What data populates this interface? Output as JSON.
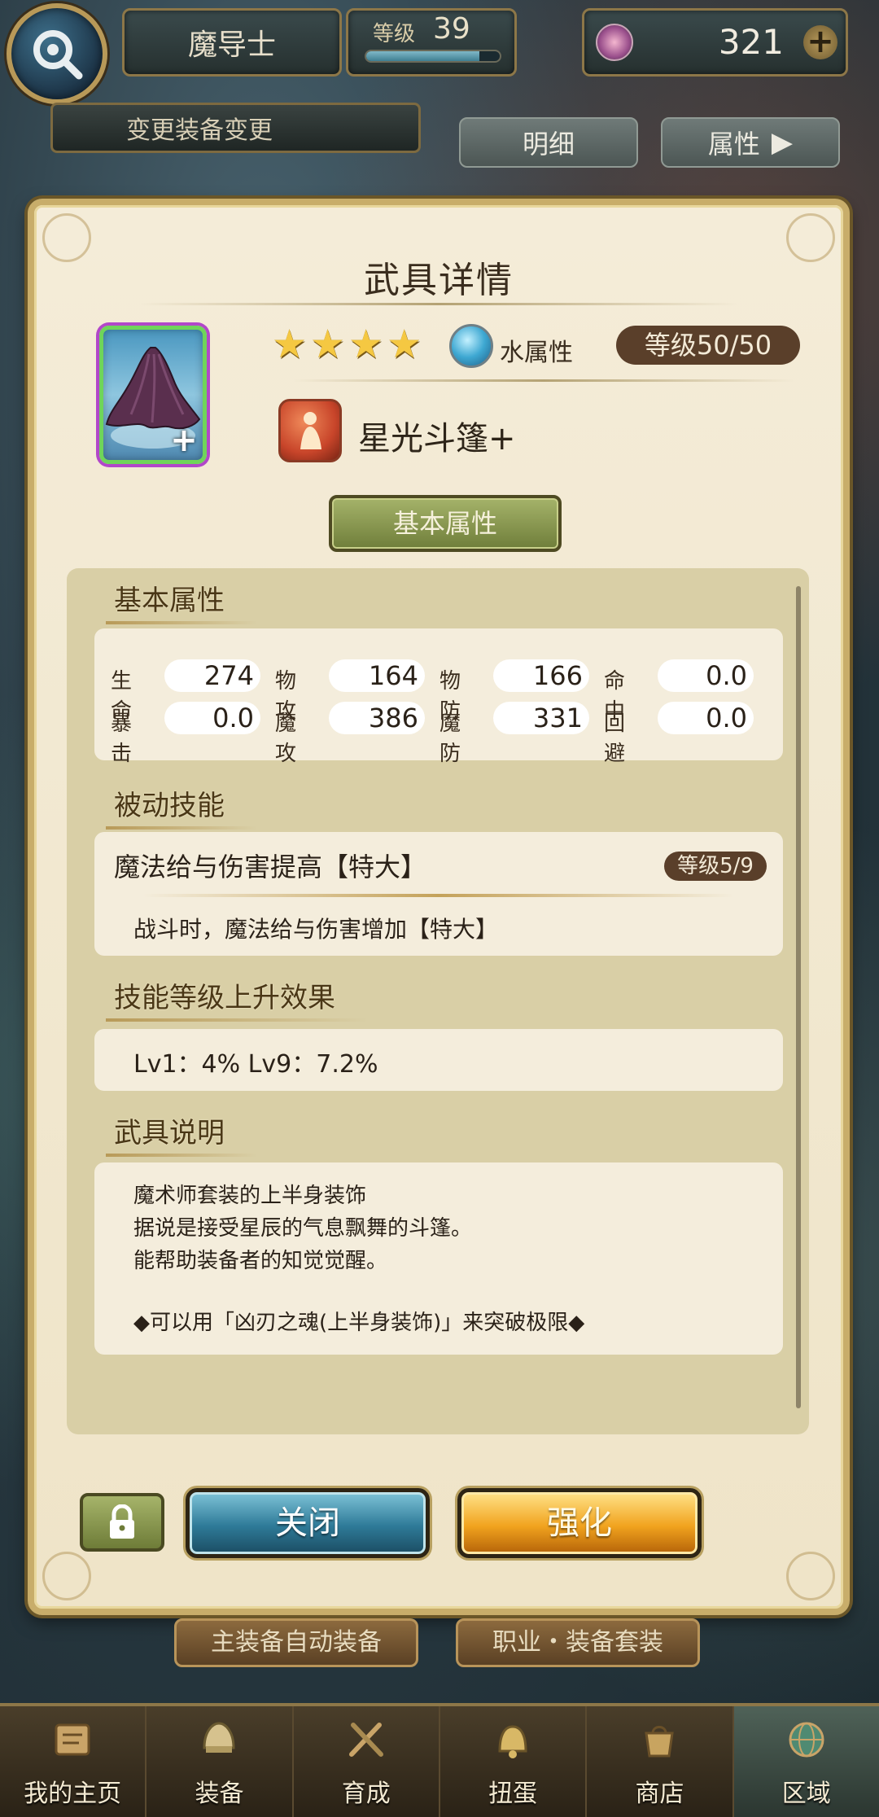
{
  "header": {
    "job": "魔导士",
    "level_label": "等级",
    "level_value": "39",
    "level_progress": 0.85,
    "gems": "321"
  },
  "top_actions": {
    "change_equip": "变更装备变更",
    "detail": "明细",
    "attribute": "属性"
  },
  "panel": {
    "title": "武具详情",
    "stars": 4,
    "element_label": "水属性",
    "level_pill": "等级50/50",
    "item_name": "星光斗篷+",
    "basic_tab": "基本属性"
  },
  "stats": {
    "heading": "基本属性",
    "rows": [
      [
        {
          "label": "生命",
          "value": "274"
        },
        {
          "label": "物攻",
          "value": "164"
        },
        {
          "label": "物防",
          "value": "166"
        },
        {
          "label": "命中",
          "value": "0.0"
        }
      ],
      [
        {
          "label": "暴击",
          "value": "0.0"
        },
        {
          "label": "魔攻",
          "value": "386"
        },
        {
          "label": "魔防",
          "value": "331"
        },
        {
          "label": "回避",
          "value": "0.0"
        }
      ]
    ]
  },
  "passive": {
    "heading": "被动技能",
    "skill_name": "魔法给与伤害提高【特大】",
    "skill_level": "等级5/9",
    "skill_desc": "战斗时，魔法给与伤害增加【特大】"
  },
  "skill_up": {
    "heading": "技能等级上升效果",
    "text": "Lv1：4%   Lv9：7.2%"
  },
  "description": {
    "heading": "武具说明",
    "lines": [
      "魔术师套装的上半身装饰",
      "据说是接受星辰的气息飘舞的斗篷。",
      "能帮助装备者的知觉觉醒。",
      "",
      "◆可以用「凶刃之魂(上半身装饰)」来突破极限◆"
    ]
  },
  "buttons": {
    "close": "关闭",
    "enhance": "强化",
    "auto_equip": "主装备自动装备",
    "job_set": "职业・装备套装"
  },
  "nav": [
    {
      "label": "我的主页",
      "icon": "home-scroll-icon"
    },
    {
      "label": "装备",
      "icon": "equipment-helmet-icon"
    },
    {
      "label": "育成",
      "icon": "training-swords-icon"
    },
    {
      "label": "扭蛋",
      "icon": "gacha-bell-icon"
    },
    {
      "label": "商店",
      "icon": "shop-bag-icon"
    },
    {
      "label": "区域",
      "icon": "area-globe-icon"
    }
  ],
  "colors": {
    "panel_bg": "#f4ecd8",
    "inner_bg": "#d9cfa6",
    "gold_border": "#c8ad6a",
    "close_btn": "#2e7a98",
    "enhance_btn": "#f1a31e",
    "pill_brown": "#5a3f2a"
  }
}
